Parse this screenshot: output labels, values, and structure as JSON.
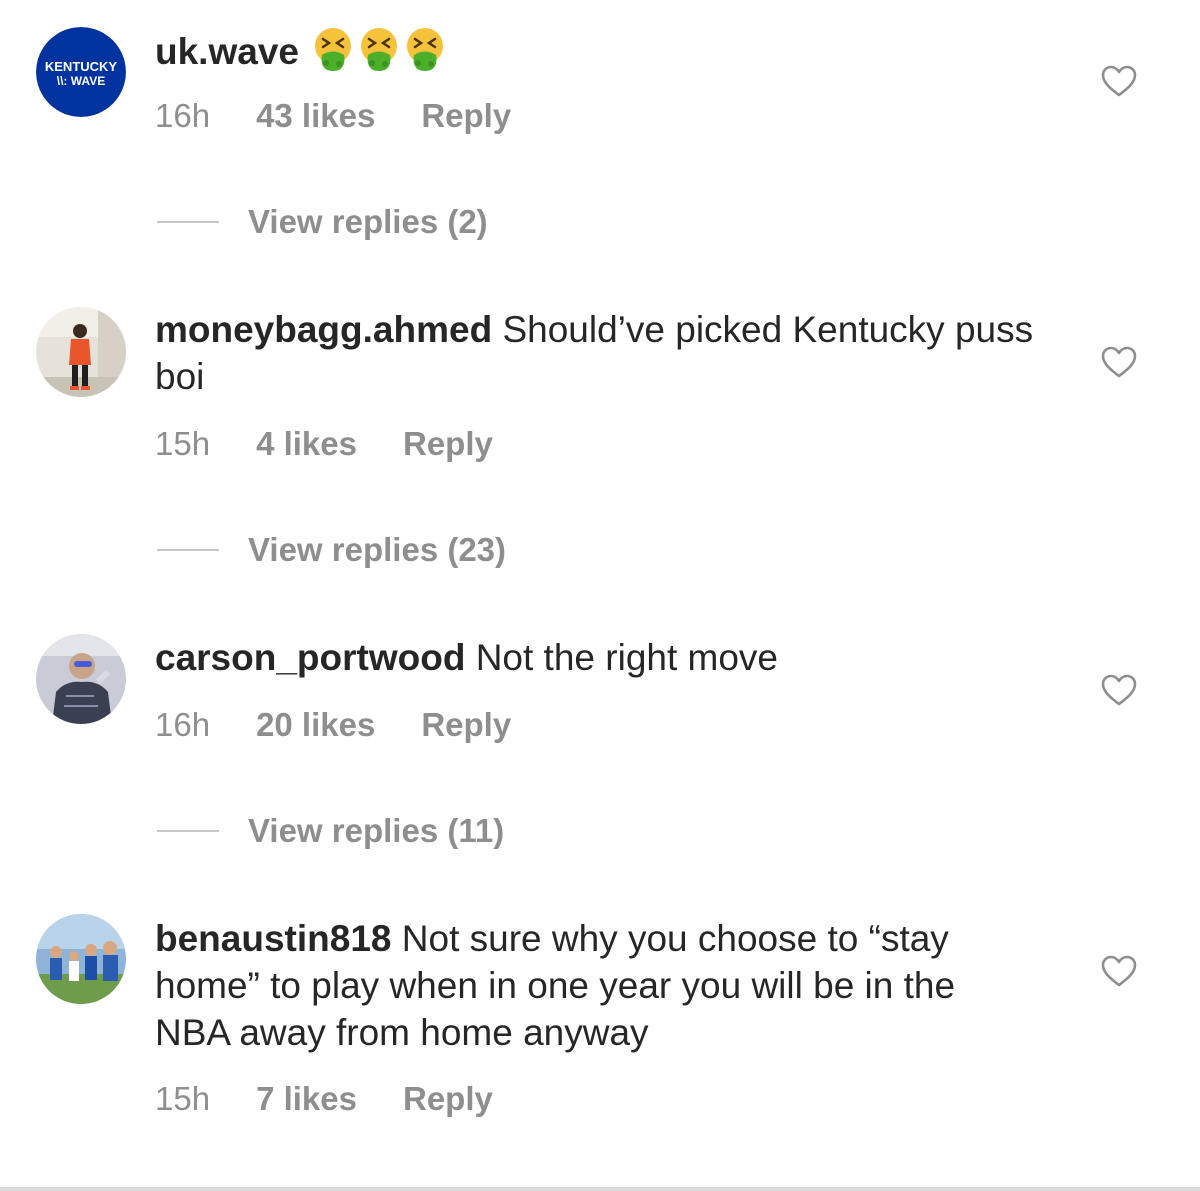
{
  "comments": [
    {
      "username": "uk.wave",
      "text": "",
      "emojis": [
        "nauseated-face-icon",
        "nauseated-face-icon",
        "nauseated-face-icon"
      ],
      "avatar": {
        "line1": "KENTUCKY",
        "line2": "\\\\: WAVE",
        "bg_color": "#0033a0"
      },
      "time": "16h",
      "likes": "43 likes",
      "reply_label": "Reply",
      "view_replies": "View replies (2)"
    },
    {
      "username": "moneybagg.ahmed",
      "text": "Should’ve picked Kentucky puss boi",
      "time": "15h",
      "likes": "4 likes",
      "reply_label": "Reply",
      "view_replies": "View replies (23)"
    },
    {
      "username": "carson_portwood",
      "text": "Not the right move",
      "time": "16h",
      "likes": "20 likes",
      "reply_label": "Reply",
      "view_replies": "View replies (11)"
    },
    {
      "username": "benaustin818",
      "text": "Not sure why you choose to “stay home” to play when in one year you will be in the NBA away from home anyway",
      "time": "15h",
      "likes": "7 likes",
      "reply_label": "Reply"
    }
  ],
  "colors": {
    "text": "#262626",
    "secondary": "#8e8e8e",
    "divider": "#c7c7c7",
    "kentucky_blue": "#0033a0"
  },
  "icons": {
    "like": "heart-outline-icon"
  }
}
